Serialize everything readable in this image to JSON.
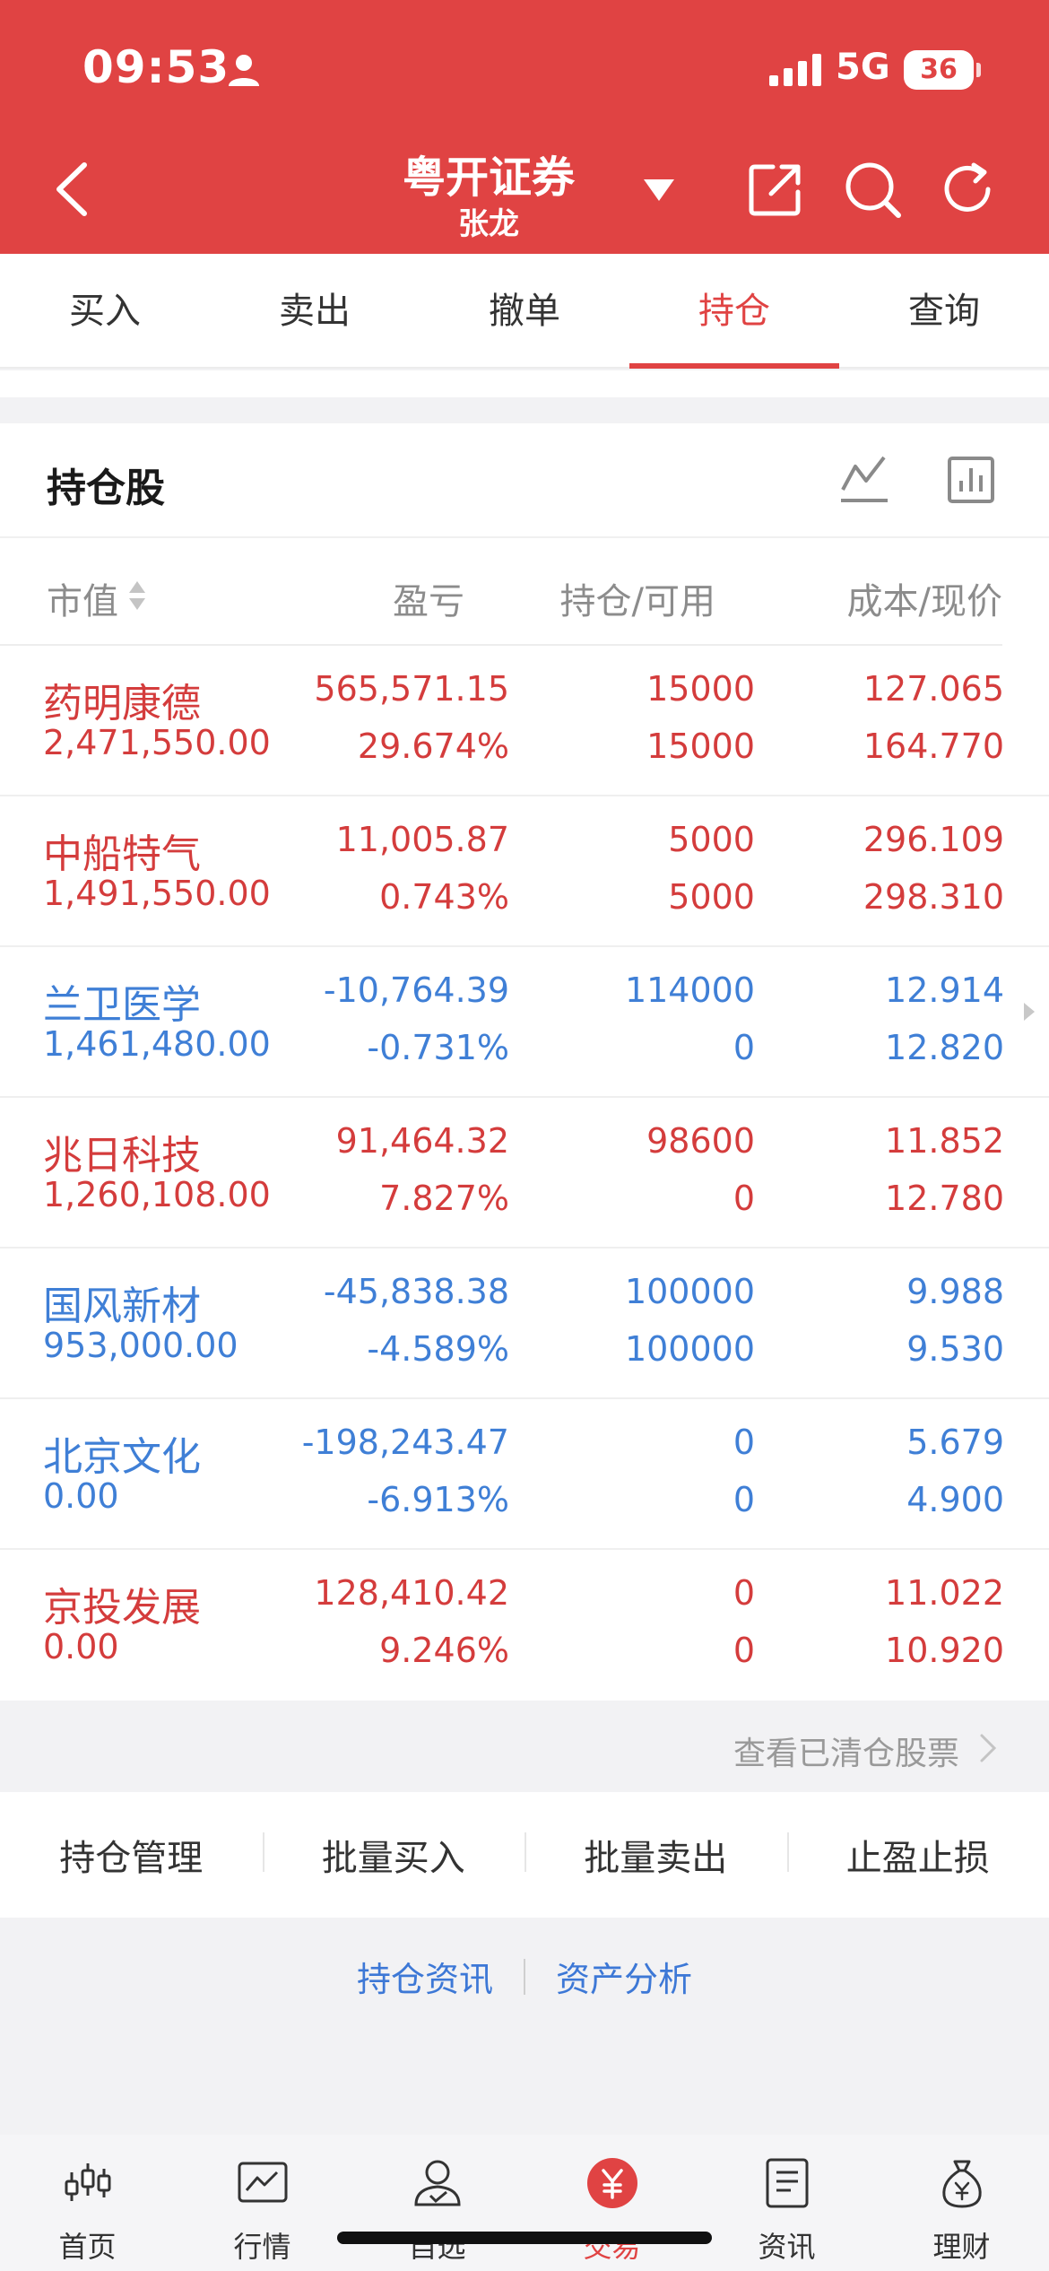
{
  "status": {
    "time": "09:53",
    "network": "5G",
    "battery": "36"
  },
  "header": {
    "title": "粤开证券",
    "user": "张龙"
  },
  "tabs": [
    {
      "label": "买入"
    },
    {
      "label": "卖出"
    },
    {
      "label": "撤单"
    },
    {
      "label": "持仓",
      "active": true
    },
    {
      "label": "查询"
    }
  ],
  "holdings": {
    "title": "持仓股",
    "columns": {
      "market_value": "市值",
      "profit_loss": "盈亏",
      "position": "持仓/可用",
      "cost_price": "成本/现价"
    },
    "rows": [
      {
        "name": "药明康德",
        "market_value": "2,471,550.00",
        "pl": "565,571.15",
        "pl_pct": "29.674%",
        "hold": "15000",
        "avail": "15000",
        "cost": "127.065",
        "price": "164.770",
        "trend": "up"
      },
      {
        "name": "中船特气",
        "market_value": "1,491,550.00",
        "pl": "11,005.87",
        "pl_pct": "0.743%",
        "hold": "5000",
        "avail": "5000",
        "cost": "296.109",
        "price": "298.310",
        "trend": "up"
      },
      {
        "name": "兰卫医学",
        "market_value": "1,461,480.00",
        "pl": "-10,764.39",
        "pl_pct": "-0.731%",
        "hold": "114000",
        "avail": "0",
        "cost": "12.914",
        "price": "12.820",
        "trend": "down"
      },
      {
        "name": "兆日科技",
        "market_value": "1,260,108.00",
        "pl": "91,464.32",
        "pl_pct": "7.827%",
        "hold": "98600",
        "avail": "0",
        "cost": "11.852",
        "price": "12.780",
        "trend": "up"
      },
      {
        "name": "国风新材",
        "market_value": "953,000.00",
        "pl": "-45,838.38",
        "pl_pct": "-4.589%",
        "hold": "100000",
        "avail": "100000",
        "cost": "9.988",
        "price": "9.530",
        "trend": "down"
      },
      {
        "name": "北京文化",
        "market_value": "0.00",
        "pl": "-198,243.47",
        "pl_pct": "-6.913%",
        "hold": "0",
        "avail": "0",
        "cost": "5.679",
        "price": "4.900",
        "trend": "down"
      },
      {
        "name": "京投发展",
        "market_value": "0.00",
        "pl": "128,410.42",
        "pl_pct": "9.246%",
        "hold": "0",
        "avail": "0",
        "cost": "11.022",
        "price": "10.920",
        "trend": "up"
      }
    ]
  },
  "cleared_link": "查看已清仓股票",
  "actions": [
    "持仓管理",
    "批量买入",
    "批量卖出",
    "止盈止损"
  ],
  "links": [
    "持仓资讯",
    "资产分析"
  ],
  "bottom_nav": [
    {
      "label": "首页",
      "icon": "candlestick-icon"
    },
    {
      "label": "行情",
      "icon": "market-chart-icon"
    },
    {
      "label": "自选",
      "icon": "user-check-icon"
    },
    {
      "label": "交易",
      "icon": "yuan-coin-icon",
      "active": true
    },
    {
      "label": "资讯",
      "icon": "news-doc-icon"
    },
    {
      "label": "理财",
      "icon": "money-bag-icon"
    }
  ],
  "colors": {
    "brand": "#e04343",
    "up": "#d43c3c",
    "down": "#3f7fd6",
    "link": "#3d78d6"
  }
}
